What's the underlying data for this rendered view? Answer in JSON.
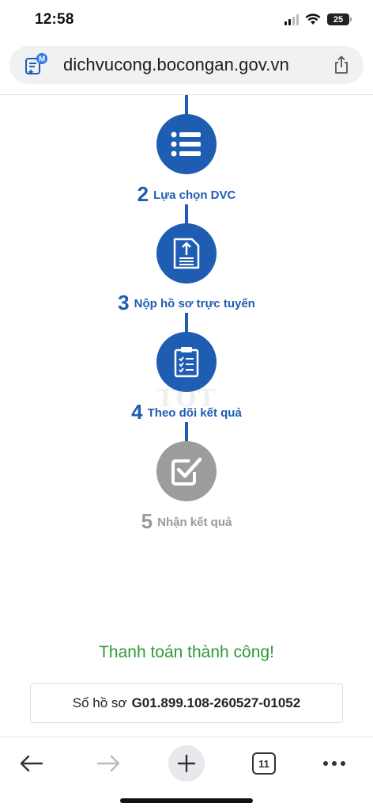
{
  "status_bar": {
    "time": "12:58",
    "battery": "25",
    "icons": [
      "signal-icon",
      "wifi-icon",
      "battery-icon"
    ]
  },
  "browser": {
    "url": "dichvucong.bocongan.gov.vn",
    "site_badge_letter": "M",
    "tab_count": "11"
  },
  "steps": [
    {
      "number": "2",
      "label": "Lựa chọn DVC",
      "icon": "list-icon",
      "state": "active"
    },
    {
      "number": "3",
      "label": "Nộp hồ sơ trực tuyến",
      "icon": "upload-document-icon",
      "state": "active"
    },
    {
      "number": "4",
      "label": "Theo dõi kết quả",
      "icon": "clipboard-checklist-icon",
      "state": "active"
    },
    {
      "number": "5",
      "label": "Nhận kết quả",
      "icon": "checkbox-checked-icon",
      "state": "inactive"
    }
  ],
  "watermark": "TỐT",
  "result": {
    "message": "Thanh toán thành công!",
    "file_label": "Số hồ sơ",
    "file_number": "G01.899.108-260527-01052"
  },
  "colors": {
    "primary": "#1f5db3",
    "inactive": "#9c9c9c",
    "success": "#2f9a33",
    "box_border": "#c8dff0"
  }
}
